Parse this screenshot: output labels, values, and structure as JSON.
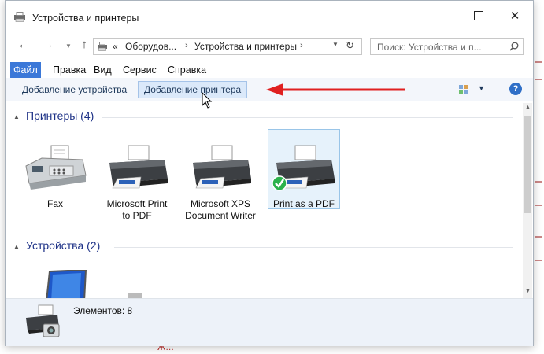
{
  "window": {
    "title": "Устройства и принтеры",
    "controls": {
      "minimize": "—",
      "close": "✕"
    }
  },
  "navigation": {
    "back": "←",
    "forward": "→",
    "up": "↑",
    "address": {
      "overflow": "«",
      "segments": [
        "Оборудов...",
        "Устройства и принтеры"
      ]
    },
    "refresh": "↻",
    "search_placeholder": "Поиск: Устройства и п..."
  },
  "menu": {
    "items": [
      {
        "label": "Файл",
        "active": true
      },
      {
        "label": "Правка",
        "active": false
      },
      {
        "label": "Вид",
        "active": false
      },
      {
        "label": "Сервис",
        "active": false
      },
      {
        "label": "Справка",
        "active": false
      }
    ]
  },
  "toolbar": {
    "add_device": "Добавление устройства",
    "add_printer": "Добавление принтера",
    "help": "?"
  },
  "groups": {
    "printers": {
      "title": "Принтеры (4)",
      "items": [
        {
          "label": "Fax",
          "icon": "fax-icon",
          "default": false,
          "selected": false
        },
        {
          "label": "Microsoft Print to PDF",
          "icon": "printer-icon",
          "default": false,
          "selected": false
        },
        {
          "label": "Microsoft XPS Document Writer",
          "icon": "printer-icon",
          "default": false,
          "selected": false
        },
        {
          "label": "Print as a PDF",
          "icon": "printer-icon",
          "default": true,
          "selected": true
        }
      ]
    },
    "devices": {
      "title": "Устройства (2)"
    }
  },
  "status": {
    "text": "Элементов: 8"
  },
  "background": {
    "bottom_text": "Ж…"
  },
  "colors": {
    "accent": "#3b78d8",
    "group_title": "#1e3287",
    "arrow": "#e02020",
    "default_check": "#2bb24c"
  }
}
